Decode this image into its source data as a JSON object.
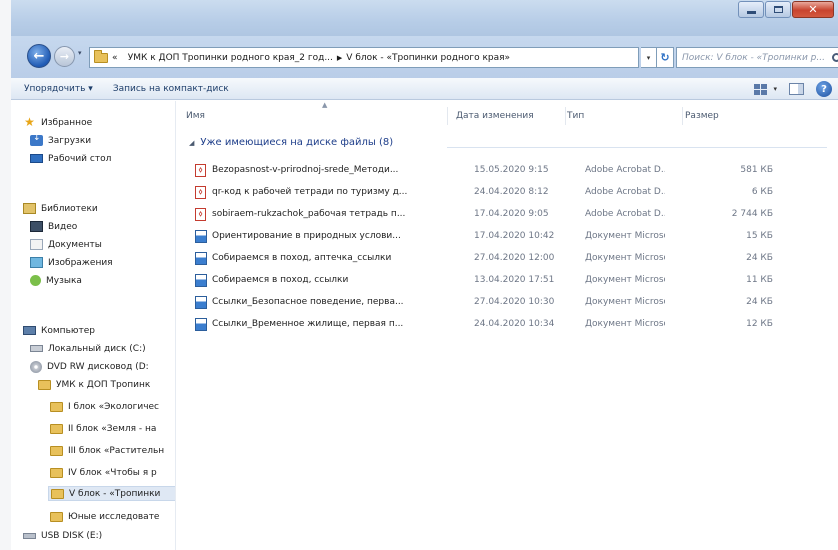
{
  "window": {
    "address": {
      "prefix": "«",
      "segments": [
        "УМК к ДОП Тропинки родного края_2 год...",
        "V блок - «Тропинки родного края»"
      ]
    },
    "search_placeholder": "Поиск: V блок - «Тропинки р..."
  },
  "toolbar": {
    "organize": "Упорядочить ▾",
    "burn": "Запись на компакт-диск"
  },
  "navpane": {
    "favorites": {
      "label": "Избранное",
      "items": [
        "Загрузки",
        "Рабочий стол"
      ]
    },
    "libraries": {
      "label": "Библиотеки",
      "items": [
        "Видео",
        "Документы",
        "Изображения",
        "Музыка"
      ]
    },
    "computer": {
      "label": "Компьютер",
      "drives": [
        "Локальный диск (C:)",
        "DVD RW дисковод (D:"
      ],
      "umk": "УМК к ДОП Тропинк",
      "folders": [
        "I блок «Экологичес",
        "II блок «Земля - на",
        "III блок «Растительн",
        "IV блок «Чтобы я р",
        "V блок - «Тропинки",
        "Юные исследовате"
      ],
      "usb": "USB DISK (E:)"
    }
  },
  "columns": {
    "name": "Имя",
    "date": "Дата изменения",
    "type": "Тип",
    "size": "Размер"
  },
  "group": {
    "label": "Уже имеющиеся на диске файлы (8)"
  },
  "files": [
    {
      "icon": "pdf",
      "name": "Bezopasnost-v-prirodnoj-srede_Методи...",
      "date": "15.05.2020 9:15",
      "type": "Adobe Acrobat D...",
      "size": "581 КБ"
    },
    {
      "icon": "pdf",
      "name": "qr-код к рабочей тетради по туризму д...",
      "date": "24.04.2020 8:12",
      "type": "Adobe Acrobat D...",
      "size": "6 КБ"
    },
    {
      "icon": "pdf",
      "name": "sobiraem-rukzachok_рабочая тетрадь п...",
      "date": "17.04.2020 9:05",
      "type": "Adobe Acrobat D...",
      "size": "2 744 КБ"
    },
    {
      "icon": "doc",
      "name": "Ориентирование в природных услови...",
      "date": "17.04.2020 10:42",
      "type": "Документ Microso...",
      "size": "15 КБ"
    },
    {
      "icon": "doc",
      "name": "Собираемся в поход, аптечка_ссылки",
      "date": "27.04.2020 12:00",
      "type": "Документ Microso...",
      "size": "24 КБ"
    },
    {
      "icon": "doc",
      "name": "Собираемся в поход, ссылки",
      "date": "13.04.2020 17:51",
      "type": "Документ Microso...",
      "size": "11 КБ"
    },
    {
      "icon": "doc",
      "name": "Ссылки_Безопасное поведение, перва...",
      "date": "27.04.2020 10:30",
      "type": "Документ Microso...",
      "size": "24 КБ"
    },
    {
      "icon": "doc",
      "name": "Ссылки_Временное жилище, первая п...",
      "date": "24.04.2020 10:34",
      "type": "Документ Microso...",
      "size": "12 КБ"
    }
  ]
}
